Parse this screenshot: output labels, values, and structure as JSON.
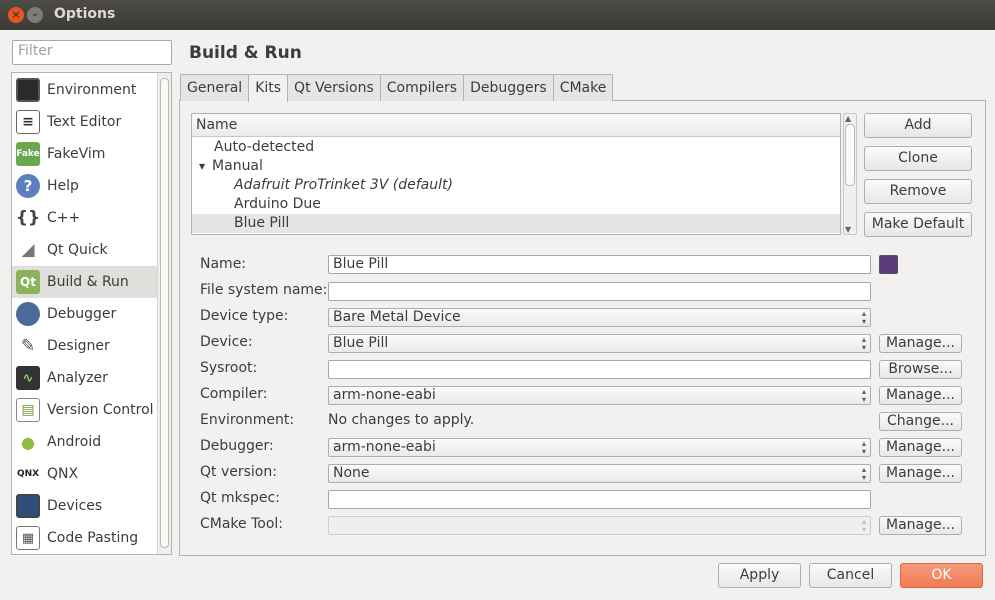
{
  "window": {
    "title": "Options"
  },
  "filter": {
    "placeholder": "Filter"
  },
  "sidebar": {
    "items": [
      {
        "label": "Environment",
        "icon": "monitor-icon"
      },
      {
        "label": "Text Editor",
        "icon": "text-editor-icon"
      },
      {
        "label": "FakeVim",
        "icon": "fakevim-icon"
      },
      {
        "label": "Help",
        "icon": "help-icon"
      },
      {
        "label": "C++",
        "icon": "braces-icon"
      },
      {
        "label": "Qt Quick",
        "icon": "qt-quick-icon"
      },
      {
        "label": "Build & Run",
        "icon": "build-run-icon"
      },
      {
        "label": "Debugger",
        "icon": "debugger-icon"
      },
      {
        "label": "Designer",
        "icon": "designer-icon"
      },
      {
        "label": "Analyzer",
        "icon": "analyzer-icon"
      },
      {
        "label": "Version Control",
        "icon": "version-control-icon"
      },
      {
        "label": "Android",
        "icon": "android-icon"
      },
      {
        "label": "QNX",
        "icon": "qnx-icon"
      },
      {
        "label": "Devices",
        "icon": "devices-icon"
      },
      {
        "label": "Code Pasting",
        "icon": "code-pasting-icon"
      }
    ],
    "selected": "Build & Run"
  },
  "page": {
    "title": "Build & Run"
  },
  "tabs": [
    "General",
    "Kits",
    "Qt Versions",
    "Compilers",
    "Debuggers",
    "CMake"
  ],
  "active_tab": "Kits",
  "kits": {
    "header": "Name",
    "rows": [
      {
        "label": "Auto-detected"
      },
      {
        "label": "Manual",
        "expander": "▾"
      },
      {
        "label": "Adafruit ProTrinket 3V (default)"
      },
      {
        "label": "Arduino Due"
      },
      {
        "label": "Blue Pill"
      }
    ]
  },
  "kit_buttons": {
    "add": "Add",
    "clone": "Clone",
    "remove": "Remove",
    "make_default": "Make Default"
  },
  "form": {
    "name": {
      "label": "Name:",
      "value": "Blue Pill"
    },
    "file_system_name": {
      "label": "File system name:",
      "value": ""
    },
    "device_type": {
      "label": "Device type:",
      "value": "Bare Metal Device"
    },
    "device": {
      "label": "Device:",
      "value": "Blue Pill",
      "button": "Manage..."
    },
    "sysroot": {
      "label": "Sysroot:",
      "value": "",
      "button": "Browse..."
    },
    "compiler": {
      "label": "Compiler:",
      "value": "arm-none-eabi",
      "button": "Manage..."
    },
    "environment": {
      "label": "Environment:",
      "value": "No changes to apply.",
      "button": "Change..."
    },
    "debugger": {
      "label": "Debugger:",
      "value": "arm-none-eabi",
      "button": "Manage..."
    },
    "qt_version": {
      "label": "Qt version:",
      "value": "None",
      "button": "Manage..."
    },
    "qt_mkspec": {
      "label": "Qt mkspec:",
      "value": ""
    },
    "cmake_tool": {
      "label": "CMake Tool:",
      "value": "",
      "button": "Manage..."
    }
  },
  "footer": {
    "apply": "Apply",
    "cancel": "Cancel",
    "ok": "OK"
  }
}
